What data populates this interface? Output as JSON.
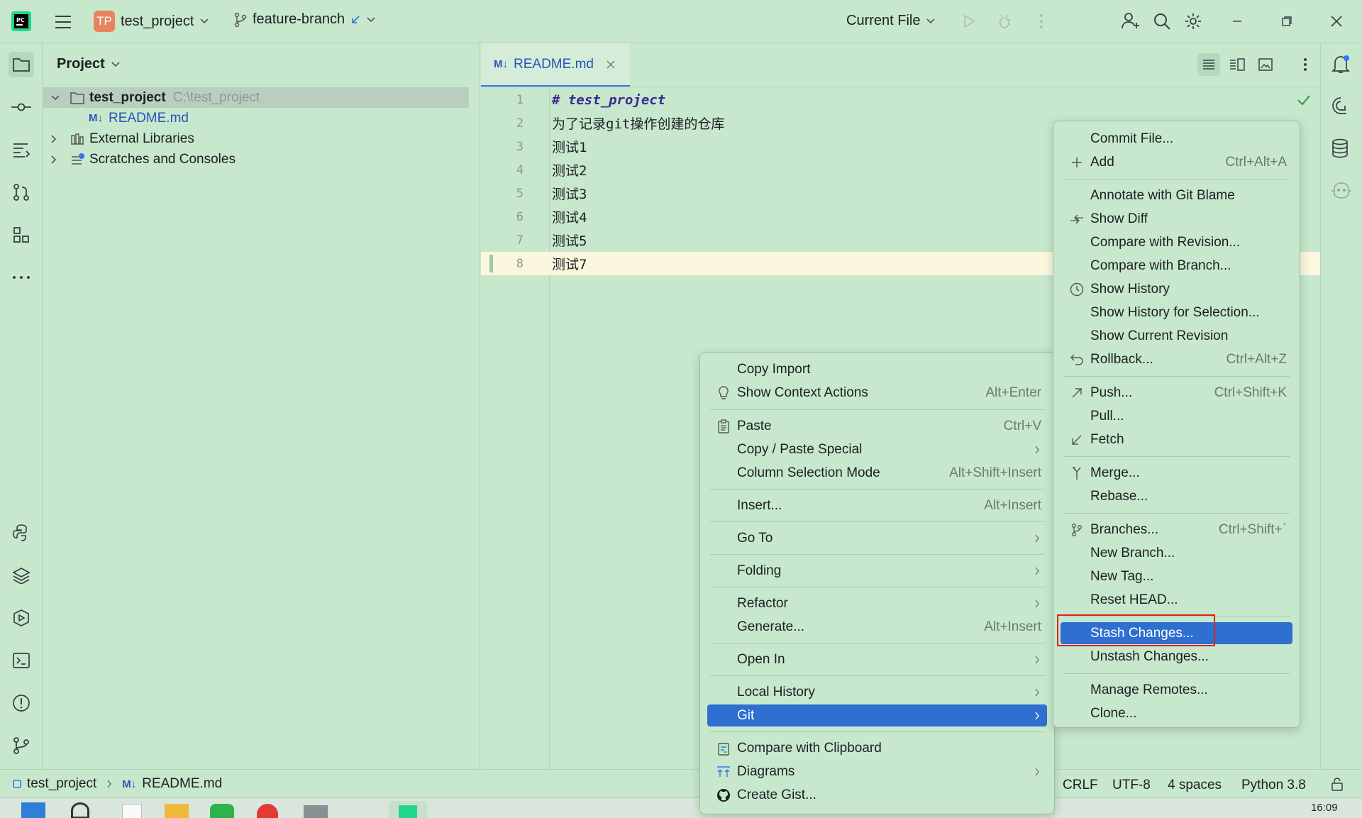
{
  "titlebar": {
    "project_badge": "TP",
    "project_name": "test_project",
    "branch": "feature-branch",
    "run_config": "Current File"
  },
  "project_panel": {
    "title": "Project",
    "tree": [
      {
        "label": "test_project",
        "hint": "C:\\test_project"
      },
      {
        "label": "README.md"
      },
      {
        "label": "External Libraries"
      },
      {
        "label": "Scratches and Consoles"
      }
    ]
  },
  "editor": {
    "tab": {
      "icon": "M↓",
      "label": "README.md"
    },
    "lines": [
      {
        "num": "1",
        "text": "# test_project"
      },
      {
        "num": "2",
        "text": "为了记录git操作创建的仓库"
      },
      {
        "num": "3",
        "text": "测试1"
      },
      {
        "num": "4",
        "text": "测试2"
      },
      {
        "num": "5",
        "text": "测试3"
      },
      {
        "num": "6",
        "text": "测试4"
      },
      {
        "num": "7",
        "text": "测试5"
      },
      {
        "num": "8",
        "text": "测试7"
      }
    ]
  },
  "context_menu": {
    "items": [
      {
        "label": "Copy Import",
        "shortcut": ""
      },
      {
        "label": "Show Context Actions",
        "shortcut": "Alt+Enter",
        "icon": "bulb-icon"
      },
      {
        "label": "Paste",
        "shortcut": "Ctrl+V",
        "icon": "clipboard-icon"
      },
      {
        "label": "Copy / Paste Special",
        "submenu": true
      },
      {
        "label": "Column Selection Mode",
        "shortcut": "Alt+Shift+Insert"
      },
      {
        "label": "Insert...",
        "shortcut": "Alt+Insert"
      },
      {
        "label": "Go To",
        "submenu": true
      },
      {
        "label": "Folding",
        "submenu": true
      },
      {
        "label": "Refactor",
        "submenu": true
      },
      {
        "label": "Generate...",
        "shortcut": "Alt+Insert"
      },
      {
        "label": "Open In",
        "submenu": true
      },
      {
        "label": "Local History",
        "submenu": true
      },
      {
        "label": "Git",
        "submenu": true,
        "highlighted": true
      },
      {
        "label": "Compare with Clipboard",
        "icon": "compare-clipboard-icon"
      },
      {
        "label": "Diagrams",
        "submenu": true,
        "icon": "diagram-icon"
      },
      {
        "label": "Create Gist...",
        "icon": "github-icon"
      }
    ]
  },
  "git_submenu": {
    "items": [
      {
        "label": "Commit File..."
      },
      {
        "label": "Add",
        "shortcut": "Ctrl+Alt+A",
        "icon": "plus-icon"
      },
      {
        "label": "Annotate with Git Blame"
      },
      {
        "label": "Show Diff",
        "icon": "diff-icon"
      },
      {
        "label": "Compare with Revision..."
      },
      {
        "label": "Compare with Branch..."
      },
      {
        "label": "Show History",
        "icon": "clock-icon"
      },
      {
        "label": "Show History for Selection..."
      },
      {
        "label": "Show Current Revision"
      },
      {
        "label": "Rollback...",
        "shortcut": "Ctrl+Alt+Z",
        "icon": "undo-icon"
      },
      {
        "label": "Push...",
        "shortcut": "Ctrl+Shift+K",
        "icon": "push-arrow-icon"
      },
      {
        "label": "Pull..."
      },
      {
        "label": "Fetch",
        "icon": "fetch-arrow-icon"
      },
      {
        "label": "Merge...",
        "icon": "merge-icon"
      },
      {
        "label": "Rebase..."
      },
      {
        "label": "Branches...",
        "shortcut": "Ctrl+Shift+`",
        "icon": "branch-icon"
      },
      {
        "label": "New Branch..."
      },
      {
        "label": "New Tag..."
      },
      {
        "label": "Reset HEAD..."
      },
      {
        "label": "Stash Changes...",
        "highlighted": true
      },
      {
        "label": "Unstash Changes..."
      },
      {
        "label": "Manage Remotes..."
      },
      {
        "label": "Clone..."
      }
    ]
  },
  "statusbar": {
    "breadcrumb_project": "test_project",
    "breadcrumb_file": "README.md",
    "line_sep": "CRLF",
    "encoding": "UTF-8",
    "indent": "4 spaces",
    "interpreter": "Python 3.8"
  },
  "taskbar": {
    "time": "16:09"
  },
  "colors": {
    "background": "#c7e8cd",
    "highlight": "#2e6fd0",
    "current_line": "#fbf7de",
    "annotation_red": "#e02020",
    "project_badge": "#e8825f"
  }
}
